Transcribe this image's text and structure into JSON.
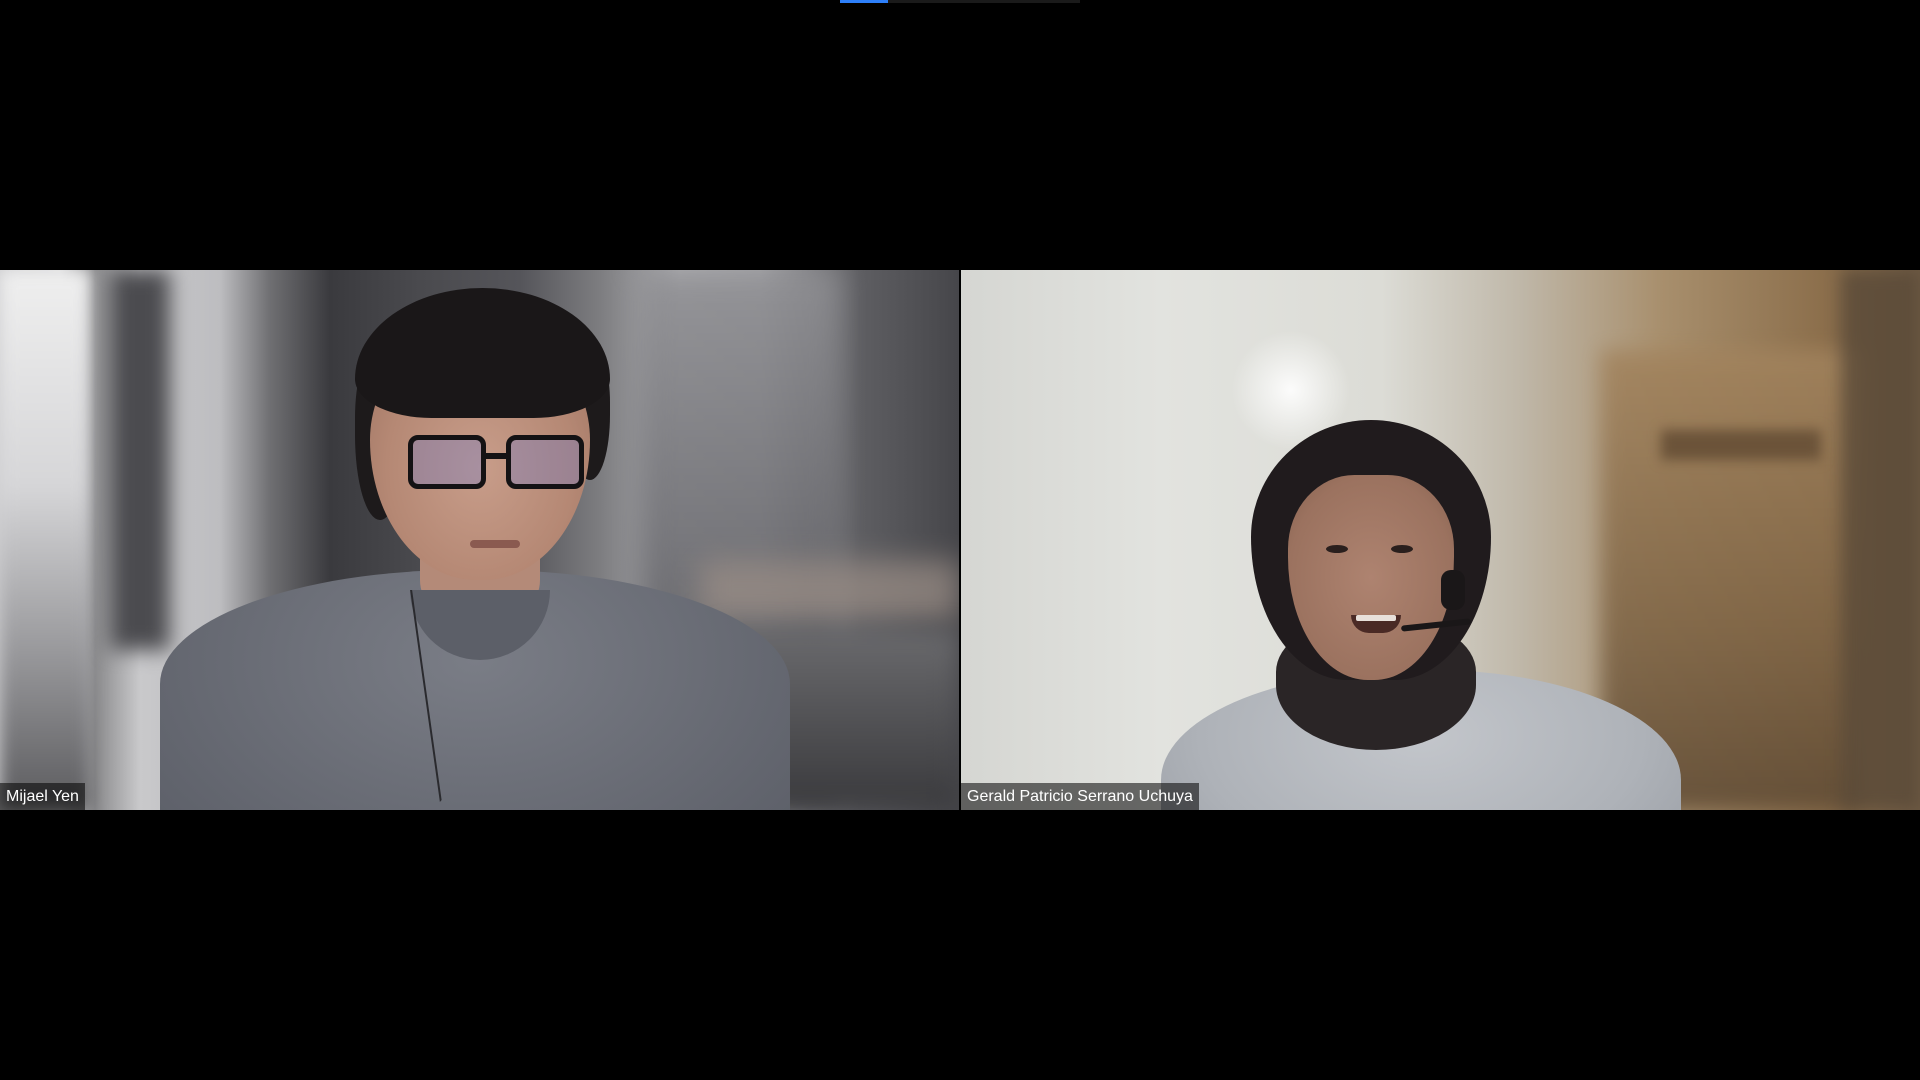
{
  "participants": [
    {
      "name": "Mijael Yen"
    },
    {
      "name": "Gerald Patricio Serrano Uchuya"
    }
  ],
  "colors": {
    "background": "#000000",
    "accent": "#2d7ff9",
    "label_text": "#ffffff"
  }
}
